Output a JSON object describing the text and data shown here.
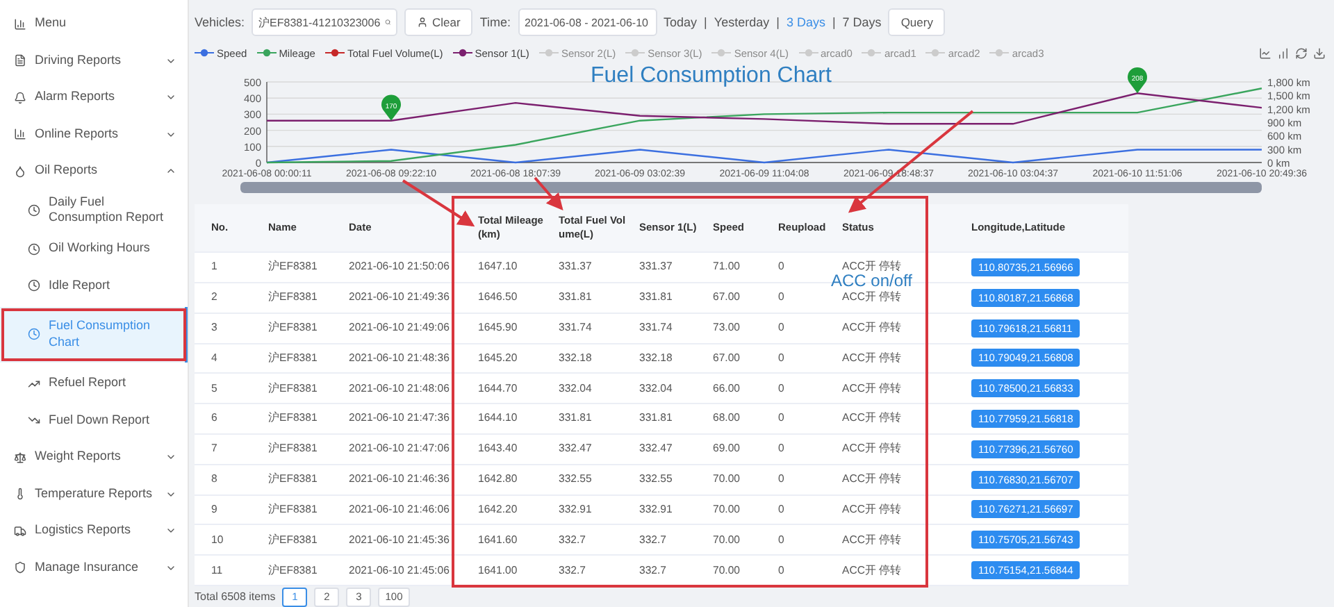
{
  "sidebar": {
    "items": [
      {
        "label": "Menu"
      },
      {
        "label": "Driving Reports",
        "expanded": false
      },
      {
        "label": "Alarm Reports",
        "expanded": false
      },
      {
        "label": "Online Reports",
        "expanded": false
      },
      {
        "label": "Oil Reports",
        "expanded": true,
        "children": [
          {
            "label": "Daily Fuel Consumption Report",
            "selected": false
          },
          {
            "label": "Oil Working Hours",
            "selected": false
          },
          {
            "label": "Idle Report",
            "selected": false
          },
          {
            "label": "Fuel Consumption Chart",
            "selected": true
          },
          {
            "label": "Refuel Report",
            "selected": false
          },
          {
            "label": "Fuel Down Report",
            "selected": false
          }
        ]
      },
      {
        "label": "Weight Reports",
        "expanded": false
      },
      {
        "label": "Temperature Reports",
        "expanded": false
      },
      {
        "label": "Logistics Reports",
        "expanded": false
      },
      {
        "label": "Manage Insurance",
        "expanded": false
      }
    ]
  },
  "toolbar": {
    "vehicles_label": "Vehicles:",
    "vehicle_value": "沪EF8381-41210323006",
    "clear": "Clear",
    "time_label": "Time:",
    "time_value": "2021-06-08 - 2021-06-10",
    "ranges": [
      {
        "label": "Today",
        "selected": false
      },
      {
        "label": "Yesterday",
        "selected": false
      },
      {
        "label": "3 Days",
        "selected": true
      },
      {
        "label": "7 Days",
        "selected": false
      }
    ],
    "separator": "|",
    "query": "Query"
  },
  "chart": {
    "inactive_legend": [
      {
        "name": "Sensor 2(L)"
      },
      {
        "name": "Sensor 3(L)"
      },
      {
        "name": "Sensor 4(L)"
      },
      {
        "name": "arcad0"
      },
      {
        "name": "arcad1"
      },
      {
        "name": "arcad2"
      },
      {
        "name": "arcad3"
      }
    ],
    "right_axis_labels": [
      "1,800 km",
      "1,500 km",
      "1,200 km",
      "900 km",
      "600 km",
      "300 km",
      "0 km"
    ],
    "markers": [
      {
        "label": "170"
      },
      {
        "label": "208"
      }
    ],
    "chart_data": {
      "type": "line",
      "title": "Fuel Consumption Chart",
      "grid": true,
      "categories": [
        "2021-06-08 00:00:11",
        "2021-06-08 09:22:10",
        "2021-06-08 18:07:39",
        "2021-06-09 03:02:39",
        "2021-06-09 11:04:08",
        "2021-06-09 18:48:37",
        "2021-06-10 03:04:37",
        "2021-06-10 11:51:06",
        "2021-06-10 20:49:36"
      ],
      "ylim": [
        0,
        500
      ],
      "yticks": [
        0,
        100,
        200,
        300,
        400,
        500
      ],
      "series": [
        {
          "name": "Speed",
          "color": "#3b6fe0",
          "values": [
            0,
            80,
            0,
            80,
            0,
            80,
            0,
            80,
            80
          ]
        },
        {
          "name": "Mileage",
          "color": "#3aa55d",
          "values": [
            0,
            10,
            110,
            260,
            300,
            310,
            310,
            310,
            460
          ]
        },
        {
          "name": "Total Fuel Volume(L)",
          "color": "#c62828",
          "values": [
            null,
            null,
            null,
            null,
            null,
            null,
            null,
            null,
            null
          ]
        },
        {
          "name": "Sensor 1(L)",
          "color": "#7b1f6e",
          "values": [
            260,
            260,
            370,
            290,
            270,
            240,
            240,
            430,
            340
          ]
        }
      ]
    }
  },
  "table": {
    "columns": [
      {
        "label": "No."
      },
      {
        "label": "Name"
      },
      {
        "label": "Date"
      },
      {
        "label": "Total Mileage(km)"
      },
      {
        "label": "Total Fuel Volume(L)"
      },
      {
        "label": "Sensor 1(L)"
      },
      {
        "label": "Speed"
      },
      {
        "label": "Reupload"
      },
      {
        "label": "Status"
      },
      {
        "label": "Longitude,Latitude"
      }
    ],
    "rows": [
      [
        "1",
        "沪EF8381",
        "2021-06-10 21:50:06",
        "1647.10",
        "331.37",
        "331.37",
        "71.00",
        "0",
        "ACC开 停转",
        "110.80735,21.56966"
      ],
      [
        "2",
        "沪EF8381",
        "2021-06-10 21:49:36",
        "1646.50",
        "331.81",
        "331.81",
        "67.00",
        "0",
        "ACC开 停转",
        "110.80187,21.56868"
      ],
      [
        "3",
        "沪EF8381",
        "2021-06-10 21:49:06",
        "1645.90",
        "331.74",
        "331.74",
        "73.00",
        "0",
        "ACC开 停转",
        "110.79618,21.56811"
      ],
      [
        "4",
        "沪EF8381",
        "2021-06-10 21:48:36",
        "1645.20",
        "332.18",
        "332.18",
        "67.00",
        "0",
        "ACC开 停转",
        "110.79049,21.56808"
      ],
      [
        "5",
        "沪EF8381",
        "2021-06-10 21:48:06",
        "1644.70",
        "332.04",
        "332.04",
        "66.00",
        "0",
        "ACC开 停转",
        "110.78500,21.56833"
      ],
      [
        "6",
        "沪EF8381",
        "2021-06-10 21:47:36",
        "1644.10",
        "331.81",
        "331.81",
        "68.00",
        "0",
        "ACC开 停转",
        "110.77959,21.56818"
      ],
      [
        "7",
        "沪EF8381",
        "2021-06-10 21:47:06",
        "1643.40",
        "332.47",
        "332.47",
        "69.00",
        "0",
        "ACC开 停转",
        "110.77396,21.56760"
      ],
      [
        "8",
        "沪EF8381",
        "2021-06-10 21:46:36",
        "1642.80",
        "332.55",
        "332.55",
        "70.00",
        "0",
        "ACC开 停转",
        "110.76830,21.56707"
      ],
      [
        "9",
        "沪EF8381",
        "2021-06-10 21:46:06",
        "1642.20",
        "332.91",
        "332.91",
        "70.00",
        "0",
        "ACC开 停转",
        "110.76271,21.56697"
      ],
      [
        "10",
        "沪EF8381",
        "2021-06-10 21:45:36",
        "1641.60",
        "332.7",
        "332.7",
        "70.00",
        "0",
        "ACC开 停转",
        "110.75705,21.56743"
      ],
      [
        "11",
        "沪EF8381",
        "2021-06-10 21:45:06",
        "1641.00",
        "332.7",
        "332.7",
        "70.00",
        "0",
        "ACC开 停转",
        "110.75154,21.56844"
      ]
    ]
  },
  "pagination": {
    "total": "Total 6508 items",
    "pages": [
      {
        "label": "1",
        "selected": true
      },
      {
        "label": "2",
        "selected": false
      },
      {
        "label": "3",
        "selected": false
      }
    ],
    "last": "100"
  },
  "annotation": {
    "label": "ACC on/off"
  }
}
